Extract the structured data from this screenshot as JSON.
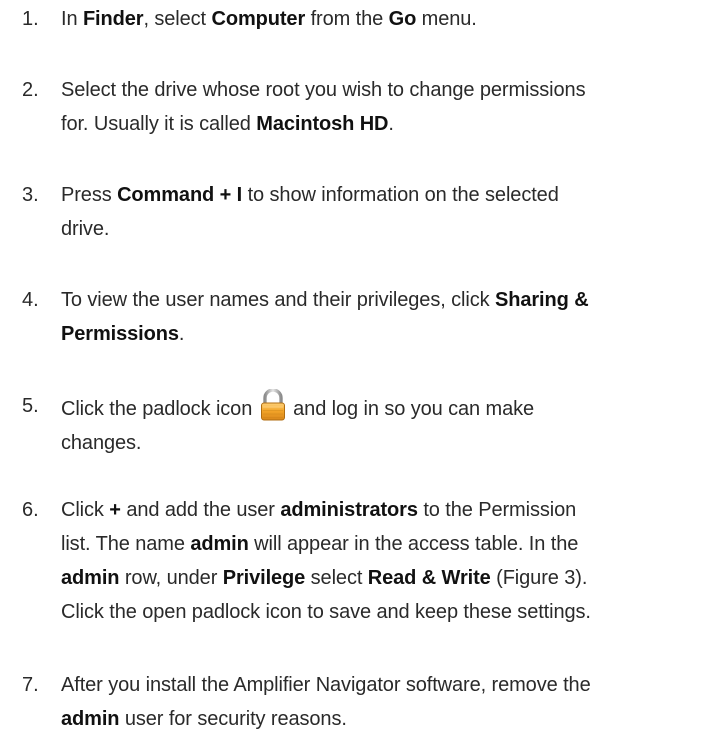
{
  "steps": [
    {
      "number": "1.",
      "parts": [
        "In ",
        "Finder",
        ", select ",
        "Computer",
        " from the ",
        "Go",
        " menu."
      ]
    },
    {
      "number": "2.",
      "line1": "Select the drive whose root you wish to change permissions",
      "line2_pre": "for. Usually it is called ",
      "line2_bold": "Macintosh HD",
      "line2_post": "."
    },
    {
      "number": "3.",
      "pre": "Press ",
      "bold": "Command + I",
      "post": " to show information on the selected",
      "line2": "drive."
    },
    {
      "number": "4.",
      "pre": "To view the user names and their privileges, click ",
      "bold1": "Sharing &",
      "bold2": "Permissions",
      "post": "."
    },
    {
      "number": "5.",
      "pre": "Click the padlock icon ",
      "post": " and log in so you can make",
      "line2": "changes.",
      "icon": "padlock-icon"
    },
    {
      "number": "6.",
      "l1_pre": "Click ",
      "l1_plus": "+",
      "l1_mid": " and add the user ",
      "l1_bold": "administrators",
      "l1_post": " to the Permission",
      "l2_pre": "list. The name ",
      "l2_bold": "admin",
      "l2_post": " will appear in the access table. In the",
      "l3_bold1": "admin",
      "l3_mid1": " row, under ",
      "l3_bold2": "Privilege",
      "l3_mid2": " select ",
      "l3_bold3": "Read & Write",
      "l3_post": " (Figure 3).",
      "l4": "Click the open padlock icon to save and keep these settings."
    },
    {
      "number": "7.",
      "line1": "After you install the Amplifier Navigator software, remove the",
      "l2_bold": "admin",
      "l2_post": " user for security reasons."
    }
  ],
  "colors": {
    "text": "#2a2a2a",
    "bold": "#111111",
    "padlock_body": "#f0a92a",
    "padlock_shackle": "#a8a8a8"
  }
}
